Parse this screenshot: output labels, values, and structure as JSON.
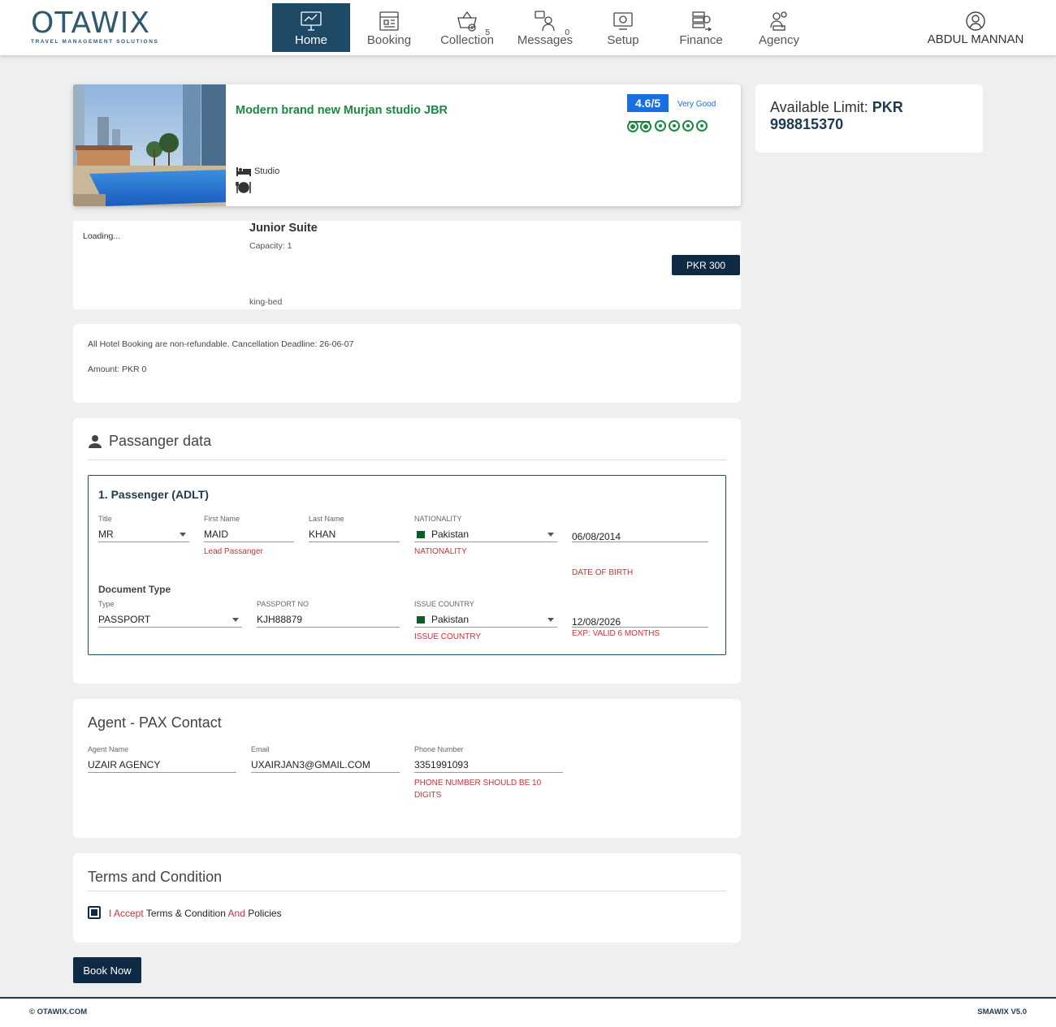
{
  "brand": {
    "name": "OTAWIX",
    "tagline": "TRAVEL MANAGEMENT SOLUTIONS",
    "color": "#2f5a6e"
  },
  "nav": {
    "items": [
      {
        "label": "Home",
        "icon": "home-monitor-icon",
        "active": true,
        "badge": ""
      },
      {
        "label": "Booking",
        "icon": "booking-icon",
        "active": false,
        "badge": ""
      },
      {
        "label": "Collection",
        "icon": "collection-basket-icon",
        "active": false,
        "badge": "5"
      },
      {
        "label": "Messages",
        "icon": "messages-icon",
        "active": false,
        "badge": "0"
      },
      {
        "label": "Setup",
        "icon": "setup-gear-icon",
        "active": false,
        "badge": ""
      },
      {
        "label": "Finance",
        "icon": "finance-icon",
        "active": false,
        "badge": ""
      },
      {
        "label": "Agency",
        "icon": "agency-icon",
        "active": false,
        "badge": ""
      }
    ],
    "active_color": "#1e4a68"
  },
  "user": {
    "name": "ABDUL MANNAN",
    "icon": "user-avatar-icon"
  },
  "hotel": {
    "name": "Modern brand new Murjan studio JBR",
    "rating": "4.6/5",
    "rating_text": "Very Good",
    "rating_bubbles": 4,
    "room_type": "Studio",
    "name_color": "#1b8a3f"
  },
  "limit": {
    "label": "Available Limit:",
    "value": "PKR 998815370"
  },
  "room": {
    "loading": "Loading...",
    "title": "Junior Suite",
    "capacity": "Capacity: 1",
    "bed": "king-bed",
    "price": "PKR 300"
  },
  "policy": {
    "line1": "All Hotel Booking are non-refundable. Cancellation Deadline: 26-06-07",
    "line2": "Amount: PKR 0"
  },
  "passenger": {
    "section_title": "Passanger data",
    "box_title": "1. Passenger (ADLT)",
    "title": {
      "label": "Title",
      "value": "MR"
    },
    "first_name": {
      "label": "First Name",
      "value": "MAID",
      "error": "Lead Passanger"
    },
    "last_name": {
      "label": "Last Name",
      "value": "KHAN"
    },
    "nationality": {
      "label": "NATIONALITY",
      "value": "Pakistan",
      "error": "NATIONALITY"
    },
    "dob": {
      "value": "06/08/2014",
      "error": "DATE OF BIRTH"
    },
    "document_type_title": "Document Type",
    "doc_type": {
      "label": "Type",
      "value": "PASSPORT"
    },
    "passport_no": {
      "label": "PASSPORT NO",
      "value": "KJH88879"
    },
    "issue_country": {
      "label": "ISSUE COUNTRY",
      "value": "Pakistan",
      "error": "ISSUE COUNTRY"
    },
    "expiry": {
      "value": "12/08/2026",
      "error": "EXP: VALID 6 MONTHS"
    }
  },
  "contact": {
    "section_title": "Agent - PAX Contact",
    "agent_name": {
      "label": "Agent Name",
      "value": "UZAIR AGENCY"
    },
    "email": {
      "label": "Email",
      "value": "UXAIRJAN3@GMAIL.COM"
    },
    "phone": {
      "label": "Phone Number",
      "value": "3351991093",
      "error": "PHONE NUMBER SHOULD BE 10 DIGITS"
    }
  },
  "terms": {
    "section_title": "Terms and Condition",
    "accept": "I Accept",
    "terms_link": "Terms & Condition",
    "and": "And",
    "policies": "Policies",
    "checked": true
  },
  "book_button": "Book Now",
  "footer": {
    "left": "© OTAWIX.COM",
    "right": "SMAWIX V5.0"
  }
}
